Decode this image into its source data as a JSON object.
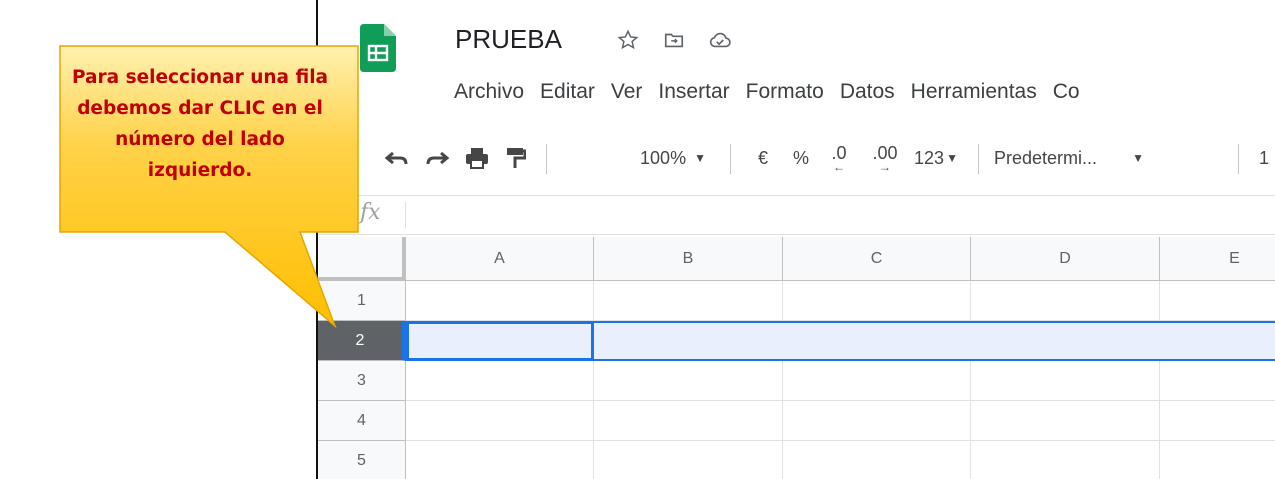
{
  "document": {
    "title": "PRUEBA",
    "icons": [
      "star-icon",
      "move-to-folder-icon",
      "cloud-saved-icon"
    ]
  },
  "menu": [
    "Archivo",
    "Editar",
    "Ver",
    "Insertar",
    "Formato",
    "Datos",
    "Herramientas",
    "Co"
  ],
  "toolbar": {
    "zoom": "100%",
    "currency": "€",
    "percent": "%",
    "decrease_decimals": ".0",
    "increase_decimals": ".00",
    "number_format": "123",
    "font": "Predetermi...",
    "font_size_partial": "1"
  },
  "formula_bar": {
    "fx": "fx"
  },
  "sheet": {
    "columns": [
      "A",
      "B",
      "C",
      "D",
      "E"
    ],
    "rows": [
      "1",
      "2",
      "3",
      "4",
      "5"
    ],
    "selected_row": "2"
  },
  "callout": {
    "text": "Para seleccionar una fila debemos dar CLIC en el número del lado izquierdo.",
    "color": "#c00000",
    "fill": "#ffc000"
  },
  "colors": {
    "accent": "#1a73e8",
    "selection_fill": "#e8f0fe",
    "sheets_green": "#0f9d58"
  }
}
